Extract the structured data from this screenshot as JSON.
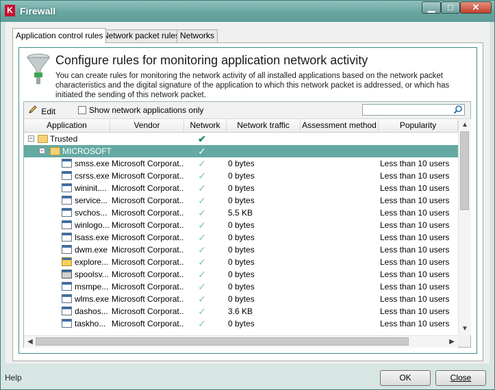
{
  "window": {
    "title": "Firewall",
    "logo_letter": "K"
  },
  "tabs": [
    {
      "label": "Application control rules",
      "active": true
    },
    {
      "label": "Network packet rules",
      "active": false
    },
    {
      "label": "Networks",
      "active": false
    }
  ],
  "panel": {
    "heading": "Configure rules for monitoring application network activity",
    "description": "You can create rules for monitoring the network activity of all installed applications based on the network packet characteristics and the digital signature of the application to which this network packet is addressed, or which has initiated the sending of this network packet."
  },
  "toolbar": {
    "edit_label": "Edit",
    "show_network_only_label": "Show network applications only",
    "show_network_only_checked": false,
    "search_value": ""
  },
  "columns": [
    "Application",
    "Vendor",
    "Network",
    "Network traffic",
    "Assessment method",
    "Popularity"
  ],
  "tree": {
    "group": {
      "label": "Trusted",
      "expanded": true
    },
    "subgroup": {
      "label": "MICROSOFT",
      "expanded": true
    }
  },
  "rows": [
    {
      "app": "smss.exe",
      "vendor": "Microsoft Corporat...",
      "traffic": "0 bytes",
      "popularity": "Less than 10 users",
      "icon": "app-icon"
    },
    {
      "app": "csrss.exe",
      "vendor": "Microsoft Corporat...",
      "traffic": "0 bytes",
      "popularity": "Less than 10 users",
      "icon": "app-icon"
    },
    {
      "app": "wininit....",
      "vendor": "Microsoft Corporat...",
      "traffic": "0 bytes",
      "popularity": "Less than 10 users",
      "icon": "app-icon"
    },
    {
      "app": "service...",
      "vendor": "Microsoft Corporat...",
      "traffic": "0 bytes",
      "popularity": "Less than 10 users",
      "icon": "app-icon"
    },
    {
      "app": "svchos...",
      "vendor": "Microsoft Corporat...",
      "traffic": "5.5 KB",
      "popularity": "Less than 10 users",
      "icon": "app-icon"
    },
    {
      "app": "winlogo...",
      "vendor": "Microsoft Corporat...",
      "traffic": "0 bytes",
      "popularity": "Less than 10 users",
      "icon": "app-icon"
    },
    {
      "app": "lsass.exe",
      "vendor": "Microsoft Corporat...",
      "traffic": "0 bytes",
      "popularity": "Less than 10 users",
      "icon": "app-icon"
    },
    {
      "app": "dwm.exe",
      "vendor": "Microsoft Corporat...",
      "traffic": "0 bytes",
      "popularity": "Less than 10 users",
      "icon": "app-icon"
    },
    {
      "app": "explore...",
      "vendor": "Microsoft Corporat...",
      "traffic": "0 bytes",
      "popularity": "Less than 10 users",
      "icon": "explorer-icon"
    },
    {
      "app": "spoolsv...",
      "vendor": "Microsoft Corporat...",
      "traffic": "0 bytes",
      "popularity": "Less than 10 users",
      "icon": "printer-icon"
    },
    {
      "app": "msmpe...",
      "vendor": "Microsoft Corporat...",
      "traffic": "0 bytes",
      "popularity": "Less than 10 users",
      "icon": "app-icon"
    },
    {
      "app": "wlms.exe",
      "vendor": "Microsoft Corporat...",
      "traffic": "0 bytes",
      "popularity": "Less than 10 users",
      "icon": "app-icon"
    },
    {
      "app": "dashos...",
      "vendor": "Microsoft Corporat...",
      "traffic": "3.6 KB",
      "popularity": "Less than 10 users",
      "icon": "app-icon"
    },
    {
      "app": "taskho...",
      "vendor": "Microsoft Corporat...",
      "traffic": "0 bytes",
      "popularity": "Less than 10 users",
      "icon": "app-icon"
    }
  ],
  "footer": {
    "help_label": "Help",
    "ok_label": "OK",
    "close_label": "Close"
  },
  "colors": {
    "accent": "#65a9a3",
    "titlebar": "#6aa6a1",
    "check": "#1d8e6c"
  }
}
